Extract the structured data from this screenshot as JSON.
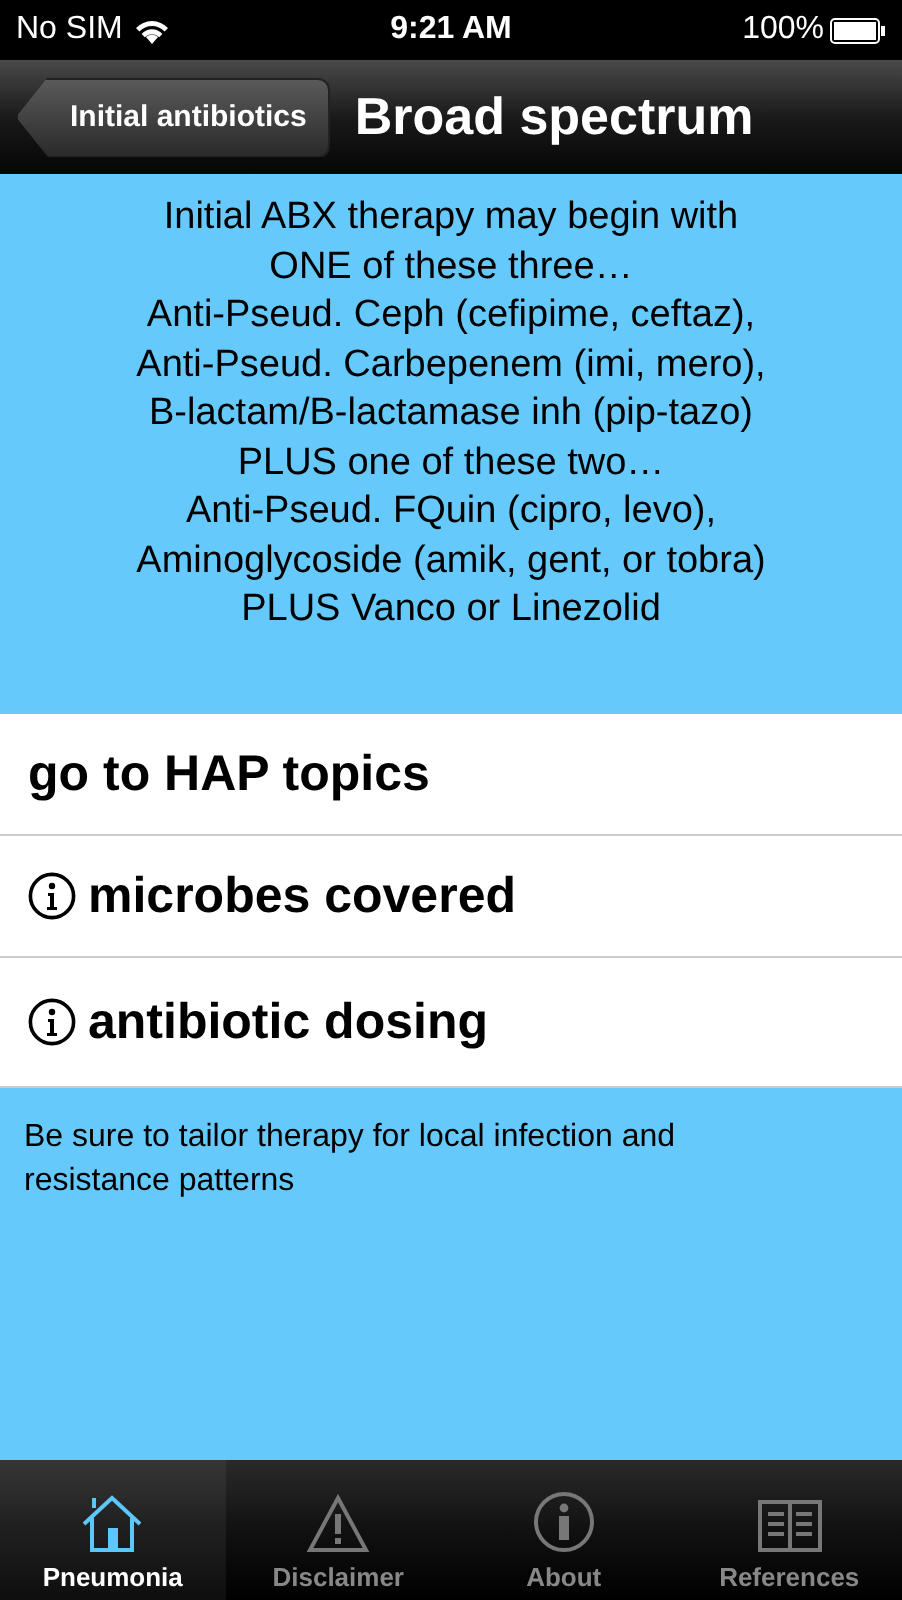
{
  "status_bar": {
    "carrier": "No SIM",
    "time": "9:21 AM",
    "battery": "100%"
  },
  "nav_bar": {
    "back": "Initial antibiotics",
    "title": "Broad spectrum"
  },
  "summary": [
    "Initial ABX therapy may begin with",
    "ONE of these three…",
    "Anti-Pseud. Ceph (cefipime, ceftaz),",
    "Anti-Pseud. Carbepenem (imi, mero),",
    "B-lactam/B-lactamase inh (pip-tazo)",
    "PLUS one of these two…",
    "Anti-Pseud. FQuin (cipro, levo),",
    "Aminoglycoside (amik, gent, or tobra)",
    "PLUS Vanco or Linezolid"
  ],
  "rows": [
    {
      "label": "go to HAP topics",
      "kind": "plain"
    },
    {
      "label": "microbes covered",
      "kind": "info"
    },
    {
      "label": "antibiotic dosing",
      "kind": "info"
    }
  ],
  "note": "Be sure to tailor therapy for local infection and resistance patterns",
  "tab_bar": [
    {
      "label": "Pneumonia",
      "kind": "home",
      "selected": true
    },
    {
      "label": "Disclaimer",
      "kind": "warning",
      "selected": false
    },
    {
      "label": "About",
      "kind": "info",
      "selected": false
    },
    {
      "label": "References",
      "kind": "book",
      "selected": false
    }
  ]
}
